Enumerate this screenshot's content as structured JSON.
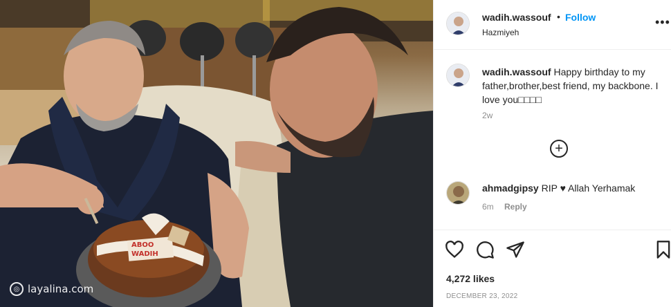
{
  "post": {
    "username": "wadih.wassouf",
    "follow_label": "Follow",
    "location": "Hazmiyeh",
    "separator": "•",
    "more_label": "•••"
  },
  "caption": {
    "username": "wadih.wassouf",
    "text": "Happy birthday to my father,brother,best friend, my backbone. I love you□□□□",
    "time": "2w"
  },
  "load_more_icon": "plus-circle-icon",
  "comments": [
    {
      "username": "ahmadgipsy",
      "text": "RIP ♥ Allah Yerhamak",
      "time": "6m",
      "reply_label": "Reply"
    }
  ],
  "actions": {
    "icons": [
      "heart-icon",
      "comment-icon",
      "share-icon",
      "bookmark-icon"
    ],
    "likes": "4,272 likes",
    "date": "DECEMBER 23, 2022"
  },
  "photo": {
    "cake_text_line1": "ABOO",
    "cake_text_line2": "WADIH",
    "watermark": "layalina.com"
  }
}
